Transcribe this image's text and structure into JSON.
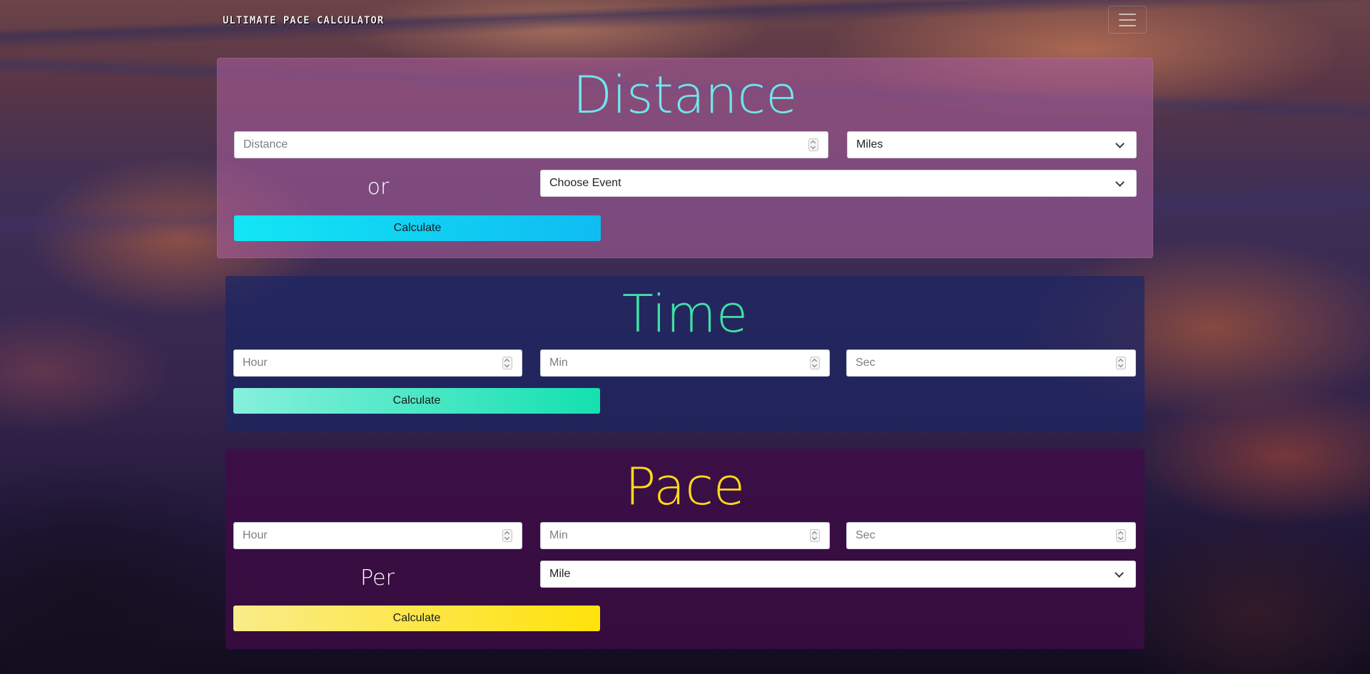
{
  "navbar": {
    "brand": "ULTIMATE PACE CALCULATOR",
    "toggle_icon": "hamburger-menu-icon"
  },
  "distance": {
    "title": "Distance",
    "distance_input": {
      "placeholder": "Distance",
      "value": ""
    },
    "unit_select": {
      "selected": "Miles"
    },
    "or_label": "or",
    "event_select": {
      "selected": "Choose Event"
    },
    "calculate_label": "Calculate",
    "colors": {
      "title": "#6fe6ee",
      "button": "#12e6f4"
    }
  },
  "time": {
    "title": "Time",
    "hour_input": {
      "placeholder": "Hour",
      "value": ""
    },
    "min_input": {
      "placeholder": "Min",
      "value": ""
    },
    "sec_input": {
      "placeholder": "Sec",
      "value": ""
    },
    "calculate_label": "Calculate",
    "colors": {
      "title": "#3fe0a6",
      "button": "#14e0b0"
    }
  },
  "pace": {
    "title": "Pace",
    "hour_input": {
      "placeholder": "Hour",
      "value": ""
    },
    "min_input": {
      "placeholder": "Min",
      "value": ""
    },
    "sec_input": {
      "placeholder": "Sec",
      "value": ""
    },
    "per_label": "Per",
    "per_select": {
      "selected": "Mile"
    },
    "calculate_label": "Calculate",
    "colors": {
      "title": "#ffd91a",
      "button": "#ffe20a"
    }
  }
}
